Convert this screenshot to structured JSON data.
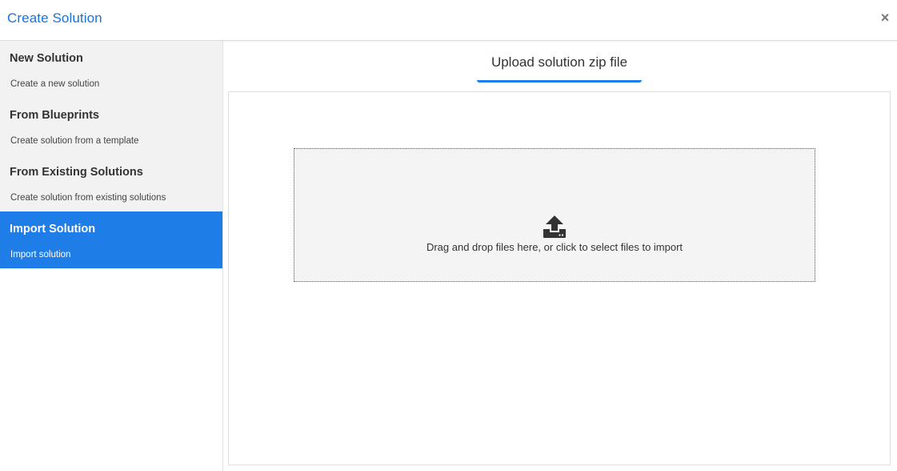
{
  "header": {
    "title": "Create Solution",
    "close_label": "×"
  },
  "sidebar": {
    "items": [
      {
        "title": "New Solution",
        "description": "Create a new solution",
        "active": false
      },
      {
        "title": "From Blueprints",
        "description": "Create solution from a template",
        "active": false
      },
      {
        "title": "From Existing Solutions",
        "description": "Create solution from existing solutions",
        "active": false
      },
      {
        "title": "Import Solution",
        "description": "Import solution",
        "active": true
      }
    ]
  },
  "main": {
    "tab_label": "Upload solution zip file",
    "dropzone": {
      "icon": "upload-icon",
      "text": "Drag and drop files here, or click to select files to import"
    }
  },
  "colors": {
    "accent": "#1f7de8",
    "title_blue": "#1a73d9",
    "sidebar_bg": "#f2f2f2",
    "dropzone_bg": "#f4f4f4"
  }
}
